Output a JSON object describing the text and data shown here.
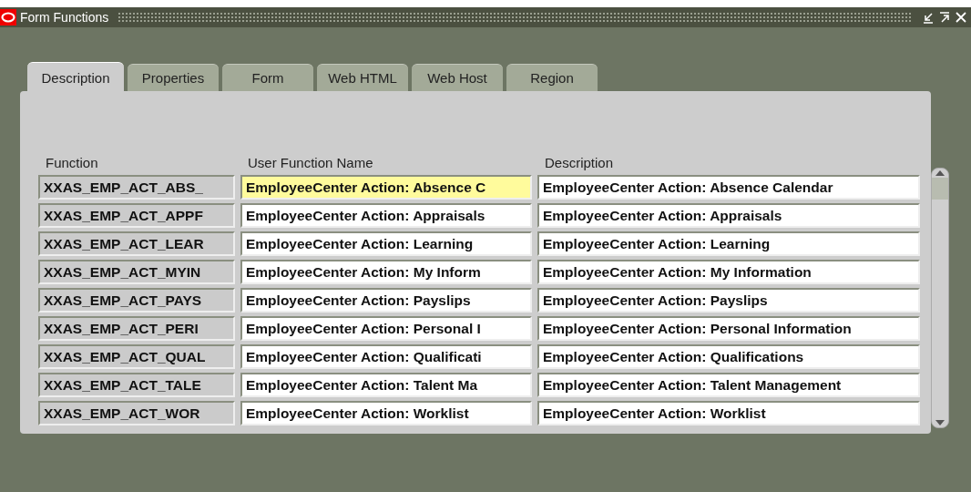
{
  "window": {
    "title": "Form Functions"
  },
  "tabs": [
    {
      "label": "Description",
      "selected": true
    },
    {
      "label": "Properties",
      "selected": false
    },
    {
      "label": "Form",
      "selected": false
    },
    {
      "label": "Web HTML",
      "selected": false
    },
    {
      "label": "Web Host",
      "selected": false
    },
    {
      "label": "Region",
      "selected": false
    }
  ],
  "table": {
    "columns": [
      "Function",
      "User Function Name",
      "Description"
    ],
    "rows": [
      {
        "function": "XXAS_EMP_ACT_ABS_",
        "user_function_name": "EmployeeCenter Action: Absence C",
        "description": "EmployeeCenter Action: Absence Calendar",
        "selected": true
      },
      {
        "function": "XXAS_EMP_ACT_APPF",
        "user_function_name": "EmployeeCenter Action: Appraisals",
        "description": "EmployeeCenter Action: Appraisals",
        "selected": false
      },
      {
        "function": "XXAS_EMP_ACT_LEAR",
        "user_function_name": "EmployeeCenter Action: Learning",
        "description": "EmployeeCenter Action: Learning",
        "selected": false
      },
      {
        "function": "XXAS_EMP_ACT_MYIN",
        "user_function_name": "EmployeeCenter Action: My Inform",
        "description": "EmployeeCenter Action: My Information",
        "selected": false
      },
      {
        "function": "XXAS_EMP_ACT_PAYS",
        "user_function_name": "EmployeeCenter Action: Payslips",
        "description": "EmployeeCenter Action: Payslips",
        "selected": false
      },
      {
        "function": "XXAS_EMP_ACT_PERI",
        "user_function_name": "EmployeeCenter Action: Personal I",
        "description": "EmployeeCenter Action: Personal Information",
        "selected": false
      },
      {
        "function": "XXAS_EMP_ACT_QUAL",
        "user_function_name": "EmployeeCenter Action: Qualificati",
        "description": "EmployeeCenter Action: Qualifications",
        "selected": false
      },
      {
        "function": "XXAS_EMP_ACT_TALE",
        "user_function_name": "EmployeeCenter Action: Talent Ma",
        "description": "EmployeeCenter Action: Talent Management",
        "selected": false
      },
      {
        "function": "XXAS_EMP_ACT_WOR",
        "user_function_name": "EmployeeCenter Action: Worklist",
        "description": "EmployeeCenter Action: Worklist",
        "selected": false
      }
    ]
  }
}
